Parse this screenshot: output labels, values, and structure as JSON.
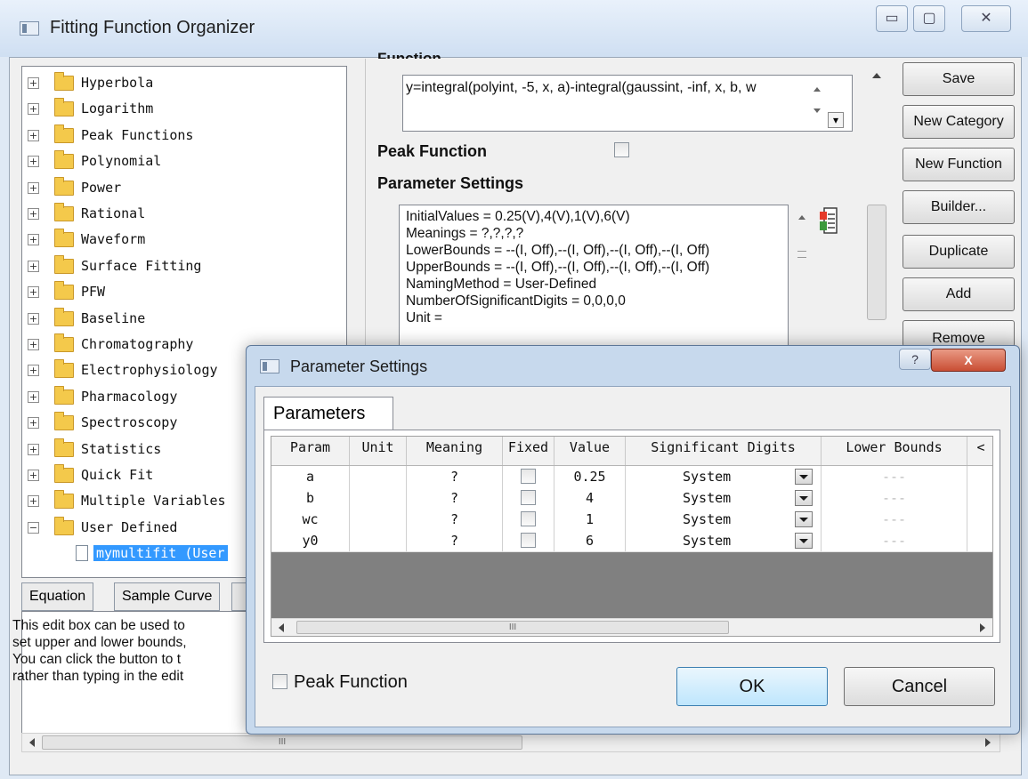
{
  "main_window": {
    "title": "Fitting Function Organizer",
    "minimize": "▭",
    "maximize": "▢",
    "close": "✕"
  },
  "tree": {
    "items": [
      {
        "label": "Hyperbola",
        "expander": "+"
      },
      {
        "label": "Logarithm",
        "expander": "+"
      },
      {
        "label": "Peak Functions",
        "expander": "+"
      },
      {
        "label": "Polynomial",
        "expander": "+"
      },
      {
        "label": "Power",
        "expander": "+"
      },
      {
        "label": "Rational",
        "expander": "+"
      },
      {
        "label": "Waveform",
        "expander": "+"
      },
      {
        "label": "Surface Fitting",
        "expander": "+"
      },
      {
        "label": "PFW",
        "expander": "+"
      },
      {
        "label": "Baseline",
        "expander": "+"
      },
      {
        "label": "Chromatography",
        "expander": "+"
      },
      {
        "label": "Electrophysiology",
        "expander": "+"
      },
      {
        "label": "Pharmacology",
        "expander": "+"
      },
      {
        "label": "Spectroscopy",
        "expander": "+"
      },
      {
        "label": "Statistics",
        "expander": "+"
      },
      {
        "label": "Quick Fit",
        "expander": "+"
      },
      {
        "label": "Multiple Variables",
        "expander": "+"
      },
      {
        "label": "User Defined",
        "expander": "−"
      }
    ],
    "selected": "mymultifit (User"
  },
  "bottom_tabs": {
    "equation": "Equation",
    "sample_curve": "Sample Curve"
  },
  "help_text": "This edit box can be used to\nset upper and lower bounds,\nYou can click the button to t\nrather than typing in the edit",
  "function_section": {
    "label": "Function",
    "expression": "y=integral(polyint, -5, x, a)-integral(gaussint, -inf, x, b, w"
  },
  "peak_function_label": "Peak Function",
  "parameter_settings_label": "Parameter Settings",
  "parameter_settings_text": "InitialValues = 0.25(V),4(V),1(V),6(V)\nMeanings = ?,?,?,?\nLowerBounds = --(I, Off),--(I, Off),--(I, Off),--(I, Off)\nUpperBounds = --(I, Off),--(I, Off),--(I, Off),--(I, Off)\nNamingMethod = User-Defined\nNumberOfSignificantDigits = 0,0,0,0\nUnit =",
  "right_buttons": {
    "save": "Save",
    "new_category": "New Category",
    "new_function": "New Function",
    "builder": "Builder...",
    "duplicate": "Duplicate",
    "add": "Add",
    "remove": "Remove"
  },
  "dialog": {
    "title": "Parameter Settings",
    "help": "?",
    "close": "X",
    "tab": "Parameters",
    "columns": [
      "Param",
      "Unit",
      "Meaning",
      "Fixed",
      "Value",
      "Significant Digits",
      "Lower Bounds",
      "<"
    ],
    "rows": [
      {
        "param": "a",
        "unit": "",
        "meaning": "?",
        "value": "0.25",
        "digits": "System",
        "lower": "---"
      },
      {
        "param": "b",
        "unit": "",
        "meaning": "?",
        "value": "4",
        "digits": "System",
        "lower": "---"
      },
      {
        "param": "wc",
        "unit": "",
        "meaning": "?",
        "value": "1",
        "digits": "System",
        "lower": "---"
      },
      {
        "param": "y0",
        "unit": "",
        "meaning": "?",
        "value": "6",
        "digits": "System",
        "lower": "---"
      }
    ],
    "scroll_thumb_grip": "III",
    "peak_function": "Peak Function",
    "ok": "OK",
    "cancel": "Cancel"
  },
  "misc": {
    "scroll_grip": "III",
    "expand_glyph": "▾"
  }
}
